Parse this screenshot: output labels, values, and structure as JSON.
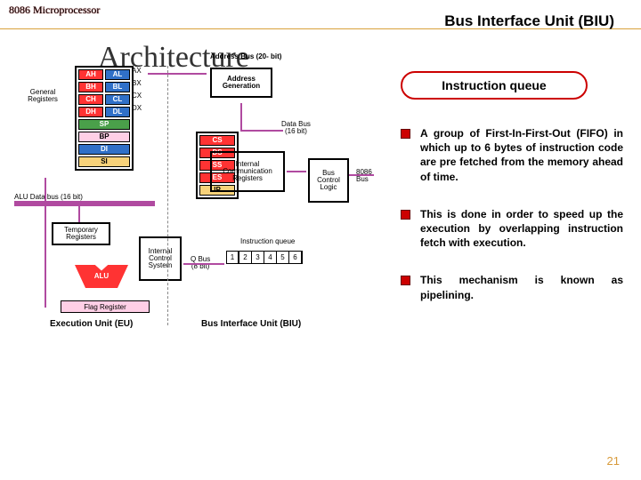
{
  "header": {
    "corner": "8086 Microprocessor",
    "title_right": "Bus Interface Unit (BIU)",
    "arch": "Architecture"
  },
  "diagram": {
    "addr_bus": "Address Bus (20- bit)",
    "addr_gen": "Address\nGeneration",
    "gen_regs_label": "General\nRegisters",
    "gen_regs": [
      [
        "AH",
        "AL"
      ],
      [
        "BH",
        "BL"
      ],
      [
        "CH",
        "CL"
      ],
      [
        "DH",
        "DL"
      ]
    ],
    "gen_regs_side": [
      "AX",
      "BX",
      "CX",
      "DX"
    ],
    "gen_regs_single": [
      "SP",
      "BP",
      "DI",
      "SI"
    ],
    "seg_regs": [
      "CS",
      "DS",
      "SS",
      "ES",
      "IP"
    ],
    "data_bus": "Data Bus\n(16 bit)",
    "icr": "Internal\nCommunication\nRegisters",
    "alu_bus": "ALU Data bus (16 bit)",
    "tmp": "Temporary\nRegisters",
    "alu": "ALU",
    "ics": "Internal\nControl\nSystem",
    "qbus": "Q Bus\n(8 bit)",
    "queue_label": "Instruction queue",
    "queue_cells": [
      "1",
      "2",
      "3",
      "4",
      "5",
      "6"
    ],
    "bcl": "Bus\nControl\nLogic",
    "bus_side": "8086\nBus",
    "flag": "Flag Register",
    "eu": "Execution Unit (EU)",
    "biu": "Bus Interface Unit (BIU)"
  },
  "right": {
    "badge": "Instruction queue",
    "bullets": [
      "A group of First-In-First-Out (FIFO) in which up to 6 bytes of instruction code are pre fetched from the memory ahead of time.",
      "This is done in order to speed up the execution by overlapping instruction fetch with execution.",
      "This mechanism is known as pipelining."
    ]
  },
  "slide_num": "21"
}
